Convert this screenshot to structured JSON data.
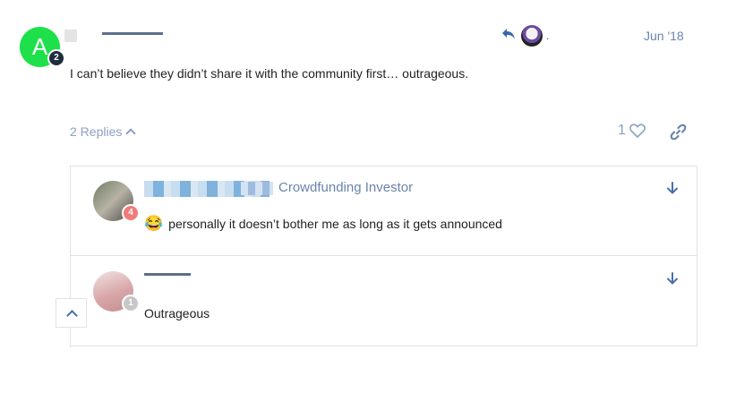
{
  "post": {
    "avatar_letter": "A",
    "avatar_badge": "2",
    "date": "Jun '18",
    "body": "I can’t believe they didn’t share it with the community first… outrageous.",
    "reply_dot": "."
  },
  "actions": {
    "replies_label": "2 Replies",
    "like_count": "1"
  },
  "replies": [
    {
      "badge": "4",
      "flair": "Crowdfunding Investor",
      "emoji": "😂",
      "text": "personally it doesn’t bother me as long as it gets announced"
    },
    {
      "badge": "1",
      "text": "Outrageous"
    }
  ],
  "colors": {
    "avatar_green": "#1ee04a",
    "link_blue": "#6a84ad",
    "muted_blue": "#8aa0c0",
    "badge_red": "#f17a7a"
  },
  "icons": [
    "reply-arrow-icon",
    "heart-icon",
    "link-icon",
    "arrow-down-icon",
    "chevron-up-icon"
  ]
}
